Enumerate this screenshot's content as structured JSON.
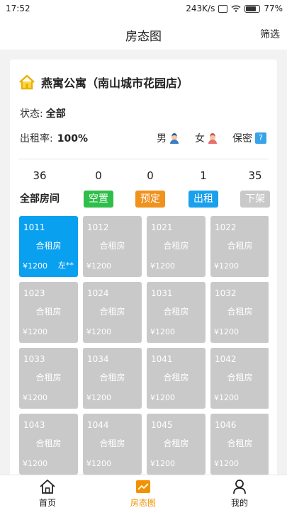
{
  "statusbar": {
    "time": "17:52",
    "speed": "243K/s",
    "battery": "77%"
  },
  "header": {
    "title": "房态图",
    "filter_label": "筛选"
  },
  "store": {
    "name": "燕寓公寓（南山城市花园店）"
  },
  "status": {
    "label": "状态:",
    "value": "全部"
  },
  "rate": {
    "label": "出租率:",
    "value": "100%"
  },
  "genders": {
    "male": "男",
    "female": "女",
    "secret": "保密",
    "secret_badge": "?"
  },
  "counts": [
    {
      "num": "36",
      "label": "全部房间",
      "color": ""
    },
    {
      "num": "0",
      "label": "空置",
      "color": "#2ebf4a"
    },
    {
      "num": "0",
      "label": "预定",
      "color": "#f0921e"
    },
    {
      "num": "1",
      "label": "出租",
      "color": "#1aa0ec"
    },
    {
      "num": "35",
      "label": "下架",
      "color": "#c9c9c9"
    }
  ],
  "rooms": [
    {
      "no": "1011",
      "type": "合租房",
      "price": "¥1200",
      "tenant": "左**",
      "active": true
    },
    {
      "no": "1012",
      "type": "合租房",
      "price": "¥1200",
      "tenant": "",
      "active": false
    },
    {
      "no": "1021",
      "type": "合租房",
      "price": "¥1200",
      "tenant": "",
      "active": false
    },
    {
      "no": "1022",
      "type": "合租房",
      "price": "¥1200",
      "tenant": "",
      "active": false
    },
    {
      "no": "1023",
      "type": "合租房",
      "price": "¥1200",
      "tenant": "",
      "active": false
    },
    {
      "no": "1024",
      "type": "合租房",
      "price": "¥1200",
      "tenant": "",
      "active": false
    },
    {
      "no": "1031",
      "type": "合租房",
      "price": "¥1200",
      "tenant": "",
      "active": false
    },
    {
      "no": "1032",
      "type": "合租房",
      "price": "¥1200",
      "tenant": "",
      "active": false
    },
    {
      "no": "1033",
      "type": "合租房",
      "price": "¥1200",
      "tenant": "",
      "active": false
    },
    {
      "no": "1034",
      "type": "合租房",
      "price": "¥1200",
      "tenant": "",
      "active": false
    },
    {
      "no": "1041",
      "type": "合租房",
      "price": "¥1200",
      "tenant": "",
      "active": false
    },
    {
      "no": "1042",
      "type": "合租房",
      "price": "¥1200",
      "tenant": "",
      "active": false
    },
    {
      "no": "1043",
      "type": "合租房",
      "price": "¥1200",
      "tenant": "",
      "active": false
    },
    {
      "no": "1044",
      "type": "合租房",
      "price": "¥1200",
      "tenant": "",
      "active": false
    },
    {
      "no": "1045",
      "type": "合租房",
      "price": "¥1200",
      "tenant": "",
      "active": false
    },
    {
      "no": "1046",
      "type": "合租房",
      "price": "¥1200",
      "tenant": "",
      "active": false
    }
  ],
  "tabs": [
    {
      "label": "首页",
      "icon": "home-icon",
      "active": false
    },
    {
      "label": "房态图",
      "icon": "chart-icon",
      "active": true
    },
    {
      "label": "我的",
      "icon": "user-icon",
      "active": false
    }
  ],
  "colors": {
    "accent": "#f39200",
    "active_room": "#0aa0f0",
    "inactive_room": "#c9c9c9"
  }
}
